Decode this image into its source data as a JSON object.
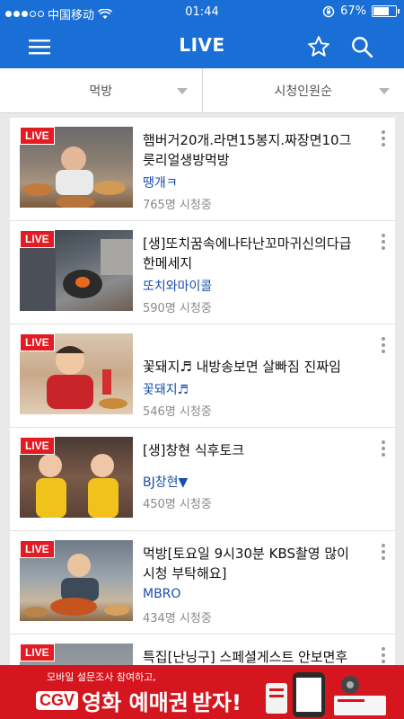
{
  "status_bar": {
    "carrier": "中国移动",
    "time": "01:44",
    "battery_text": "67%",
    "battery_level": 0.67
  },
  "app_bar": {
    "title": "LIVE",
    "menu_icon": "hamburger-menu-icon",
    "favorite_icon": "star-outline-icon",
    "search_icon": "search-icon"
  },
  "filters": {
    "category": "먹방",
    "sort": "시청인원순"
  },
  "live_badge": "LIVE",
  "streams": [
    {
      "title": "햄버거20개.라면15봉지.짜장면10그릇리얼생방먹방",
      "title_lines": [
        "햄버거20개.라면15봉지.짜장면10그",
        "릇리얼생방먹방"
      ],
      "bj": "땡개ㅋ",
      "viewers": "765명 시청중"
    },
    {
      "title": "[생]또치꿈속에나타난꼬마귀신의다급한메세지",
      "title_lines": [
        "[생]또치꿈속에나타난꼬마귀신의다급",
        "한메세지"
      ],
      "bj": "또치와마이콜",
      "viewers": "590명 시청중"
    },
    {
      "title": "꽃돼지♬ 내방송보면 살빠짐 진짜임",
      "title_lines": [
        "꽃돼지♬ 내방송보면 살빠짐 진짜임",
        ""
      ],
      "bj": "꽃돼지♬",
      "viewers": "546명 시청중"
    },
    {
      "title": "[생]창현 식후토크",
      "title_lines": [
        "[생]창현 식후토크",
        ""
      ],
      "bj": "BJ창현▼",
      "viewers": "450명 시청중"
    },
    {
      "title": "먹방[토요일 9시30분 KBS촬영 많이 시청 부탁해요]",
      "title_lines": [
        "먹방[토요일 9시30분 KBS촬영 많이",
        "시청 부탁해요]"
      ],
      "bj": "MBRO",
      "viewers": "434명 시청중"
    },
    {
      "title": "특집[난닝구] 스페셜게스트 안보면후회",
      "title_lines": [
        "특집[난닝구] 스페셜게스트 안보면후회",
        ""
      ],
      "bj": "",
      "viewers": ""
    }
  ],
  "ad": {
    "top_text": "모바일 설문조사 참여하고,",
    "brand": "CGV",
    "main_text": "영화 예매권",
    "suffix": "받자!"
  },
  "colors": {
    "primary": "#1a6fd6",
    "live_red": "#e31b23",
    "bj_blue": "#1a4ea8",
    "ad_red": "#d5161e"
  }
}
